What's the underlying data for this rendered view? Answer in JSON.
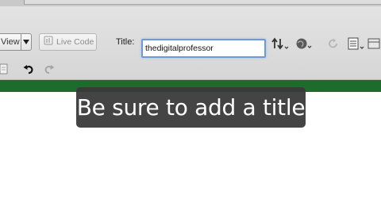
{
  "toolbar": {
    "view_label": "View",
    "live_code_label": "Live Code",
    "title_label": "Title:",
    "title_value": "thedigitalprofessor"
  },
  "icons": [
    "dropdown-arrow-icon",
    "live-code-icon",
    "file-management-icon",
    "preview-browser-icon",
    "refresh-icon",
    "view-options-icon",
    "visual-aids-icon",
    "page-icon",
    "undo-icon",
    "redo-icon"
  ],
  "caption": {
    "text": "Be sure to add a title"
  },
  "colors": {
    "green_bar": "#1e6b2e",
    "caption_bg": "#3a3a3a",
    "input_focus": "#6a9bd8"
  }
}
